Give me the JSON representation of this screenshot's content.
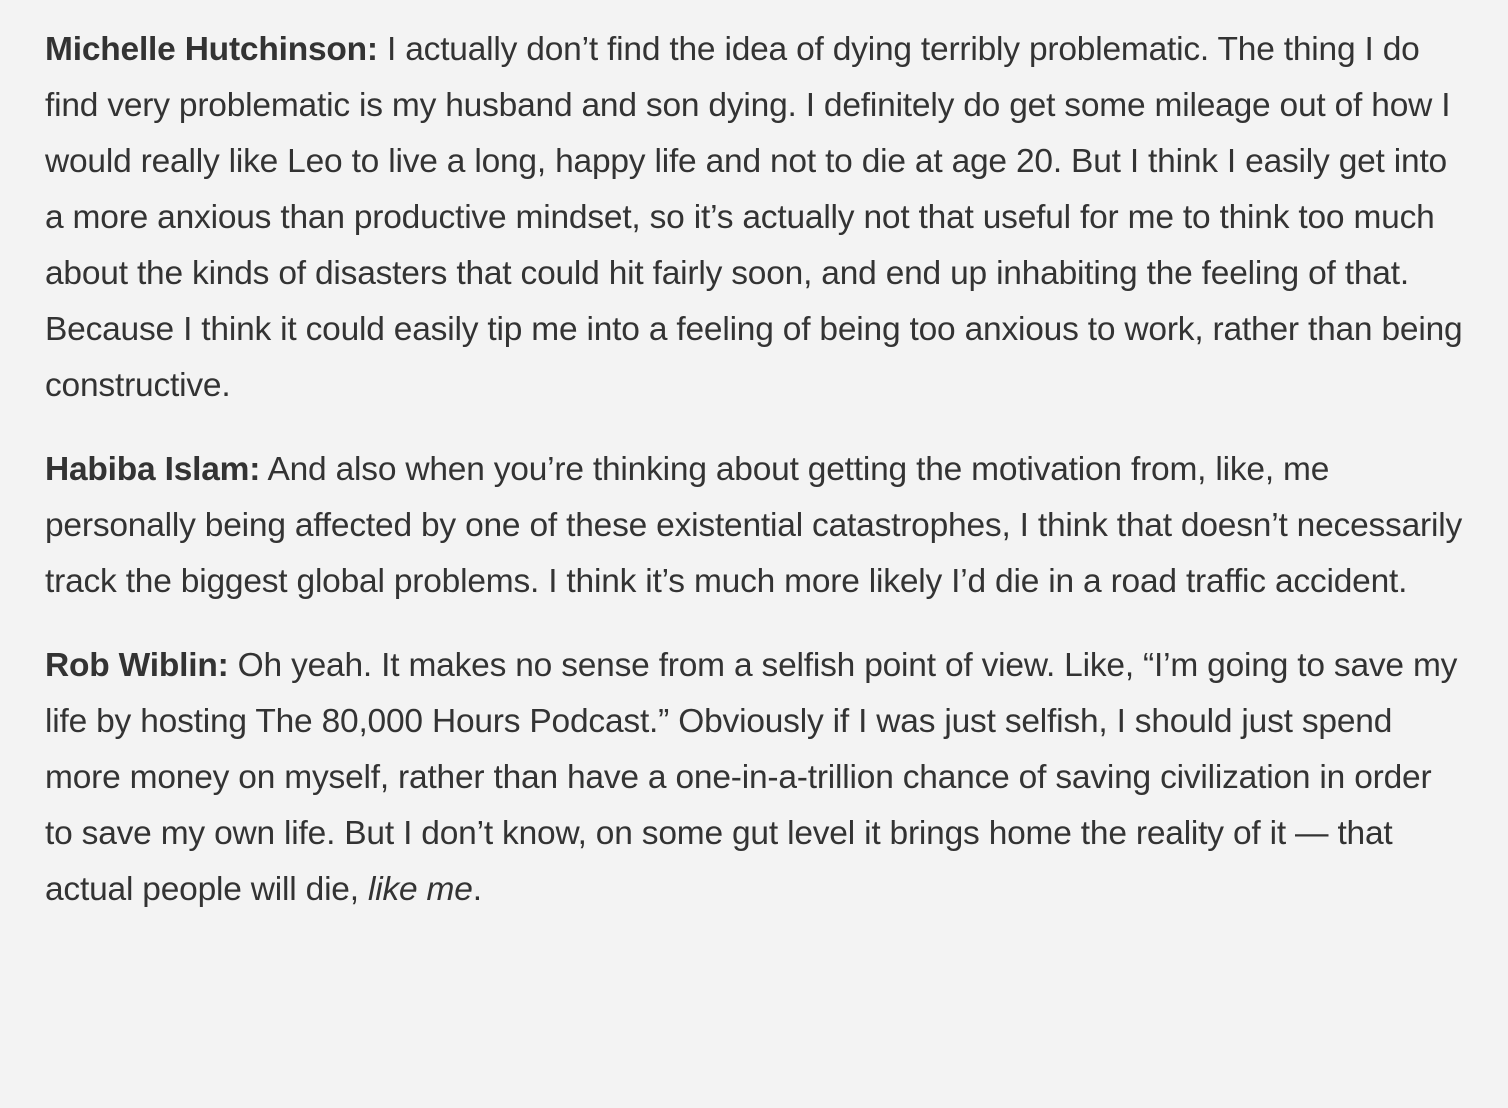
{
  "transcript": [
    {
      "speaker": "Michelle Hutchinson:",
      "text": " I actually don’t find the idea of dying terribly problematic. The thing I do find very problematic is my husband and son dying. I definitely do get some mileage out of how I would really like Leo to live a long, happy life and not to die at age 20. But I think I easily get into a more anxious than productive mindset, so it’s actually not that useful for me to think too much about the kinds of disasters that could hit fairly soon, and end up inhabiting the feeling of that. Because I think it could easily tip me into a feeling of being too anxious to work, rather than being constructive."
    },
    {
      "speaker": "Habiba Islam:",
      "text": " And also when you’re thinking about getting the motivation from, like, me personally being affected by one of these existential catastrophes, I think that doesn’t necessarily track the biggest global problems. I think it’s much more likely I’d die in a road traffic accident."
    },
    {
      "speaker": "Rob Wiblin:",
      "text": " Oh yeah. It makes no sense from a selfish point of view. Like, “I’m going to save my life by hosting The 80,000 Hours Podcast.” Obviously if I was just selfish, I should just spend more money on myself, rather than have a one-in-a-trillion chance of saving civilization in order to save my own life. But I don’t know, on some gut level it brings home the reality of it — that actual people will die, ",
      "emphasis": "like me",
      "tail": "."
    }
  ]
}
